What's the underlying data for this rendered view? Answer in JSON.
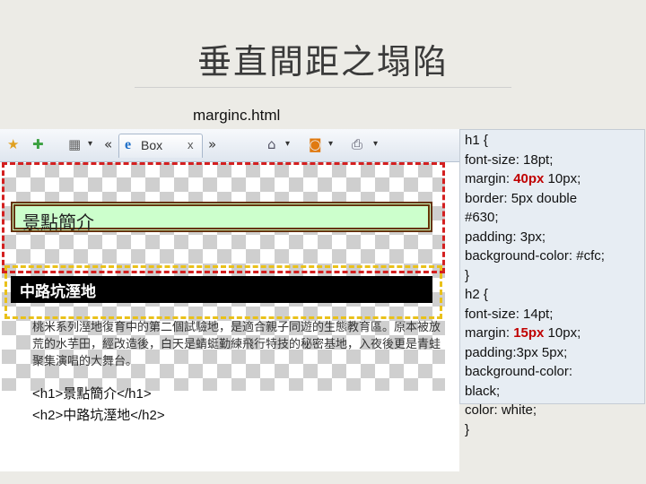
{
  "slide": {
    "title": "垂直間距之塌陷",
    "file_label": "marginc.html"
  },
  "toolbar": {
    "tab_label": "Box",
    "tab_close": "x",
    "prev_chevron": "«",
    "next_chevron": "»",
    "dropdown_arrow": "▾"
  },
  "page": {
    "h1": "景點簡介",
    "h2": "中路坑溼地",
    "paragraph": "桃米系列溼地復育中的第二個試驗地，是適合親子同遊的生態教育區。原本被放荒的水芋田，經改造後，白天是蜻蜓勤練飛行特技的秘密基地，入夜後更是青蛙聚集演唱的大舞台。",
    "code_line1": "<h1>景點簡介</h1>",
    "code_line2": "<h2>中路坑溼地</h2>"
  },
  "css": {
    "l1": "h1 {",
    "l2": "font-size: 18pt;",
    "l3a": "margin: ",
    "l3b": "40px",
    "l3c": " 10px;",
    "l4": "border: 5px double",
    "l5": "#630;",
    "l6": "padding: 3px;",
    "l7": "background-color: #cfc;",
    "l8": "}",
    "l9": "h2 {",
    "l10": "font-size: 14pt;",
    "l11a": "margin: ",
    "l11b": "15px",
    "l11c": " 10px;",
    "l12": "padding:3px 5px;",
    "l13": "background-color:",
    "l14": "black;",
    "l15": "color: white;",
    "l16": "}"
  },
  "colors": {
    "accent_red": "#c00000",
    "h1_bg": "#ccffcc",
    "h1_border": "#663300",
    "dash_red": "#d42020",
    "dash_yellow": "#e9c11a"
  }
}
